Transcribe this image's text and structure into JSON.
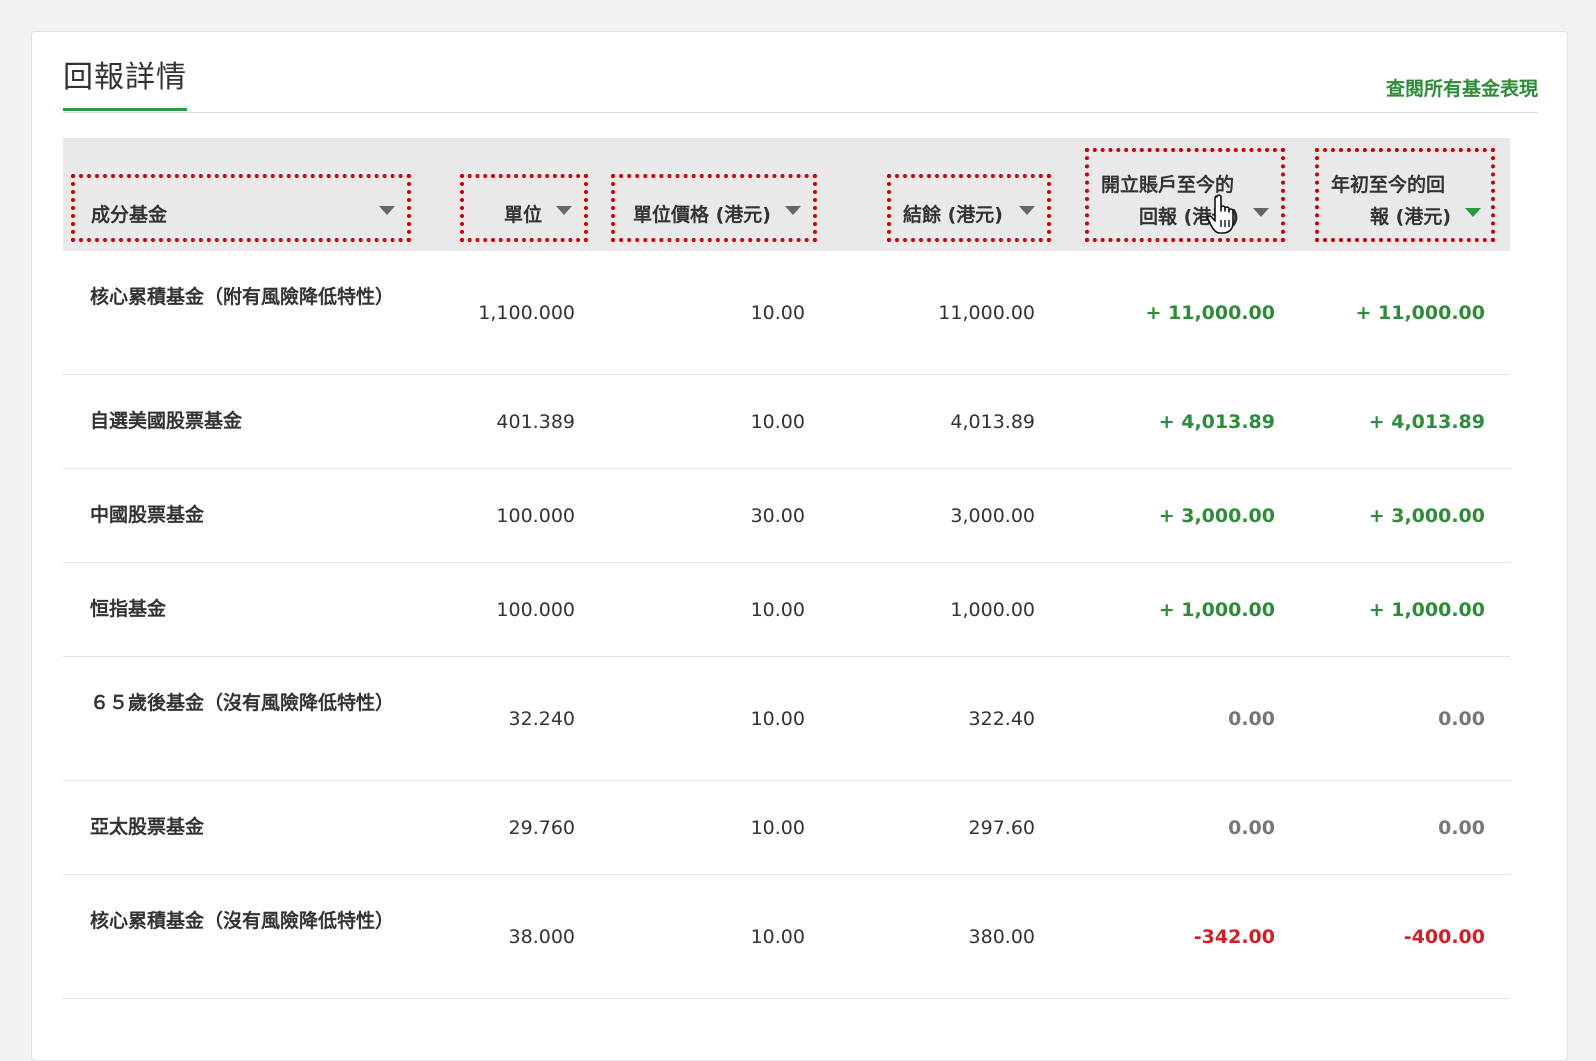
{
  "title": "回報詳情",
  "view_all_link": "查閱所有基金表現",
  "columns": [
    {
      "key": "fund",
      "label": "成分基金"
    },
    {
      "key": "units",
      "label": "單位"
    },
    {
      "key": "unit_price",
      "label": "單位價格 (港元)"
    },
    {
      "key": "balance",
      "label": "結餘 (港元)"
    },
    {
      "key": "return_since_open",
      "label_line1": "開立賬戶至今的",
      "label_line2": "回報 (港元)"
    },
    {
      "key": "return_ytd",
      "label_line1": "年初至今的回",
      "label_line2": "報 (港元)",
      "sorted": true
    }
  ],
  "rows": [
    {
      "fund": "核心累積基金（附有風險降低特性）",
      "units": "1,100.000",
      "unit_price": "10.00",
      "balance": "11,000.00",
      "return_since_open": "+ 11,000.00",
      "return_ytd": "+ 11,000.00",
      "status": "pos"
    },
    {
      "fund": "自選美國股票基金",
      "units": "401.389",
      "unit_price": "10.00",
      "balance": "4,013.89",
      "return_since_open": "+ 4,013.89",
      "return_ytd": "+ 4,013.89",
      "status": "pos"
    },
    {
      "fund": "中國股票基金",
      "units": "100.000",
      "unit_price": "30.00",
      "balance": "3,000.00",
      "return_since_open": "+ 3,000.00",
      "return_ytd": "+ 3,000.00",
      "status": "pos"
    },
    {
      "fund": "恒指基金",
      "units": "100.000",
      "unit_price": "10.00",
      "balance": "1,000.00",
      "return_since_open": "+ 1,000.00",
      "return_ytd": "+ 1,000.00",
      "status": "pos"
    },
    {
      "fund": "６５歲後基金（沒有風險降低特性）",
      "units": "32.240",
      "unit_price": "10.00",
      "balance": "322.40",
      "return_since_open": "0.00",
      "return_ytd": "0.00",
      "status": "zero"
    },
    {
      "fund": "亞太股票基金",
      "units": "29.760",
      "unit_price": "10.00",
      "balance": "297.60",
      "return_since_open": "0.00",
      "return_ytd": "0.00",
      "status": "zero"
    },
    {
      "fund": "核心累積基金（沒有風險降低特性）",
      "units": "38.000",
      "unit_price": "10.00",
      "balance": "380.00",
      "return_since_open": "-342.00",
      "return_ytd": "-400.00",
      "status": "neg"
    }
  ],
  "colors": {
    "positive": "#2e8b3a",
    "negative": "#d0202a",
    "accent": "#2e9a3e",
    "highlight": "#cc0000"
  }
}
